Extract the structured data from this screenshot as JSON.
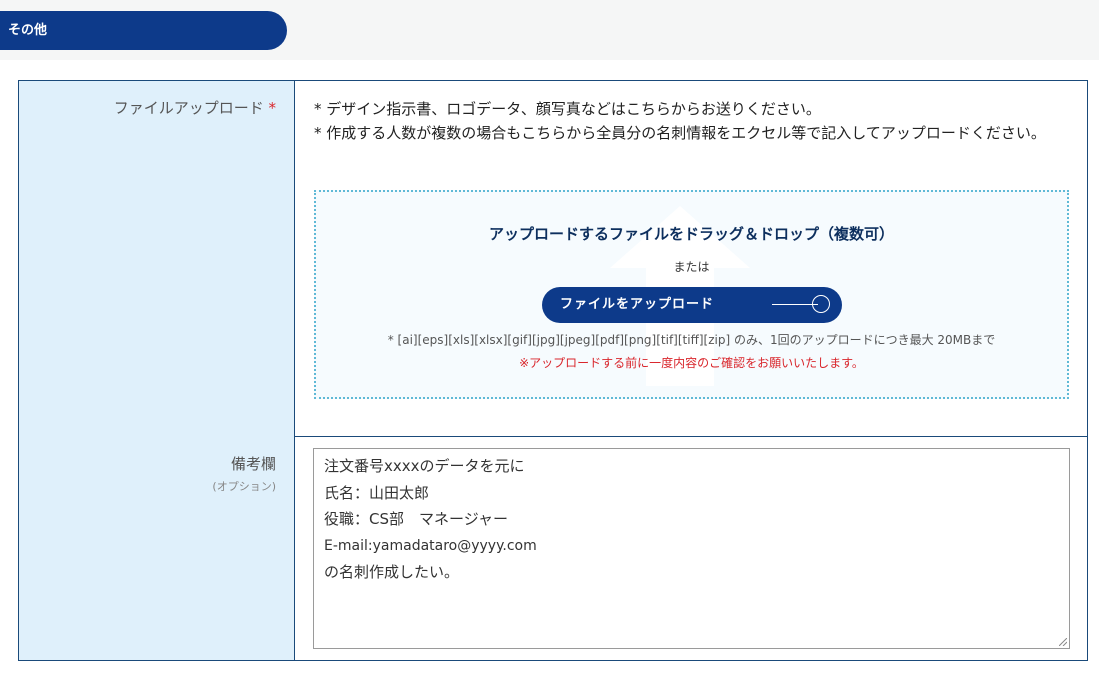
{
  "section": {
    "title": "その他"
  },
  "file_upload": {
    "label": "ファイルアップロード",
    "required_mark": "*",
    "notes": [
      "* デザイン指示書、ロゴデータ、顔写真などはこちらからお送りください。",
      "* 作成する人数が複数の場合もこちらから全員分の名刺情報をエクセル等で記入してアップロードください。"
    ],
    "dropzone": {
      "title": "アップロードするファイルをドラッグ＆ドロップ（複数可）",
      "or_text": "または",
      "button_label": "ファイルをアップロード",
      "formats": "* [ai][eps][xls][xlsx][gif][jpg][jpeg][pdf][png][tif][tiff][zip] のみ、1回のアップロードにつき最大 20MBまで",
      "warning": "※アップロードする前に一度内容のご確認をお願いいたします。"
    }
  },
  "remarks": {
    "label": "備考欄",
    "sub_label": "(オプション)",
    "lines": [
      "注文番号xxxxのデータを元に",
      "氏名：山田太郎",
      "役職：CS部　マネージャー",
      "E-mail:yamadataro@yyyy.com",
      "の名刺作成したい。"
    ]
  },
  "colors": {
    "navy": "#0d3a8a",
    "label_bg": "#dff0fb",
    "border": "#1a4a7a",
    "required": "#d9262c",
    "dropzone_border": "#5fb9d6"
  }
}
